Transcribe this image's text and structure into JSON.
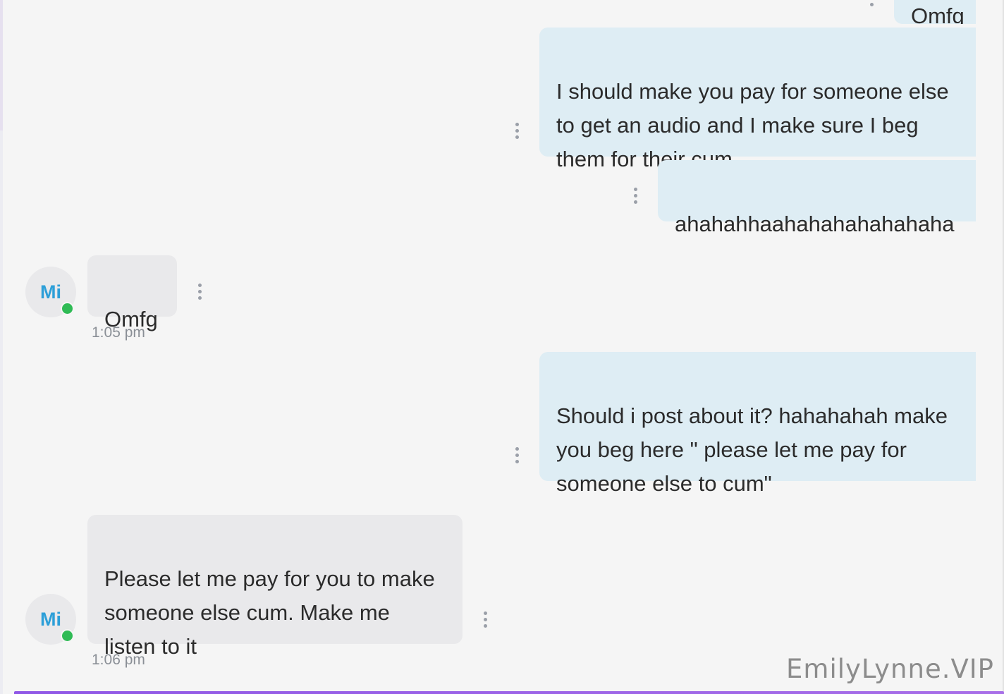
{
  "conversation": {
    "messages": [
      {
        "id": "m0",
        "direction": "sent",
        "text": "Omfg",
        "partially_visible": true
      },
      {
        "id": "m1",
        "direction": "sent",
        "text": "I should make you pay for someone else\nto get an audio and I make sure I beg\nthem for their cum"
      },
      {
        "id": "m2",
        "direction": "sent",
        "text": "ahahahhaahahahahahahaha"
      },
      {
        "id": "m3",
        "direction": "received",
        "text": "Omfg",
        "avatar": "Mi",
        "time": "1:05 pm",
        "online": true
      },
      {
        "id": "m4",
        "direction": "sent",
        "text": "Should i post about it? hahahahah make\nyou beg here \" please let me pay for\nsomeone else to cum\""
      },
      {
        "id": "m5",
        "direction": "received",
        "text": "Please let me pay for you to make\nsomeone else cum. Make me\nlisten to it",
        "avatar": "Mi",
        "time": "1:06 pm",
        "online": true
      }
    ],
    "message_menu_icon": "kebab-menu-icon",
    "online_color": "#2fbb55",
    "sent_bubble_color": "#deedf4",
    "received_bubble_color": "#e9e9eb",
    "avatar_text_color": "#2d9fd8"
  },
  "watermark": "EmilyLynne.VIP"
}
